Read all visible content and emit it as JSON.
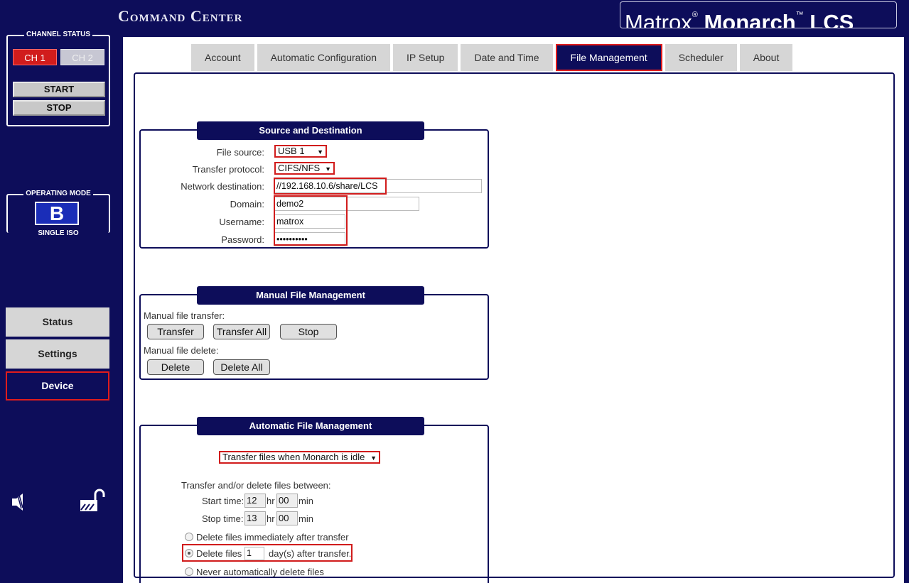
{
  "header": {
    "title": "Command Center",
    "logo": {
      "brand": "Matrox",
      "product": "Monarch",
      "model": "LCS"
    }
  },
  "sidebar": {
    "channel_status": {
      "title": "CHANNEL STATUS",
      "ch1": "CH 1",
      "ch2": "CH 2",
      "start": "START",
      "stop": "STOP"
    },
    "operating_mode": {
      "title": "OPERATING MODE",
      "mode": "B",
      "mode_label": "SINGLE ISO"
    },
    "nav": {
      "status": "Status",
      "settings": "Settings",
      "device": "Device"
    }
  },
  "tabs": [
    "Account",
    "Automatic Configuration",
    "IP Setup",
    "Date and Time",
    "File Management",
    "Scheduler",
    "About"
  ],
  "active_tab": "File Management",
  "source_destination": {
    "title": "Source and Destination",
    "file_source_label": "File source:",
    "file_source_value": "USB 1",
    "transfer_protocol_label": "Transfer protocol:",
    "transfer_protocol_value": "CIFS/NFS",
    "network_destination_label": "Network destination:",
    "network_destination_value": "//192.168.10.6/share/LCS",
    "domain_label": "Domain:",
    "domain_value": "demo2",
    "username_label": "Username:",
    "username_value": "matrox",
    "password_label": "Password:",
    "password_value": "••••••••••"
  },
  "manual": {
    "title": "Manual File Management",
    "transfer_label": "Manual file transfer:",
    "transfer": "Transfer",
    "transfer_all": "Transfer All",
    "stop": "Stop",
    "delete_label": "Manual file delete:",
    "delete": "Delete",
    "delete_all": "Delete All"
  },
  "automatic": {
    "title": "Automatic File Management",
    "mode_value": "Transfer files when Monarch is idle",
    "between_label": "Transfer and/or delete files between:",
    "start_label": "Start time:",
    "start_hr": "12",
    "start_min": "00",
    "stop_label": "Stop time:",
    "stop_hr": "13",
    "stop_min": "00",
    "hr_unit": "hr",
    "min_unit": "min",
    "opt_immediate": "Delete files immediately after transfer",
    "opt_days_prefix": "Delete files",
    "opt_days_value": "1",
    "opt_days_suffix": "day(s) after transfer.",
    "opt_never": "Never automatically delete files",
    "selected_option": "days"
  },
  "colors": {
    "navy": "#0d0d5a",
    "accent_red": "#d11c1c",
    "mode_blue": "#1a2db8"
  }
}
